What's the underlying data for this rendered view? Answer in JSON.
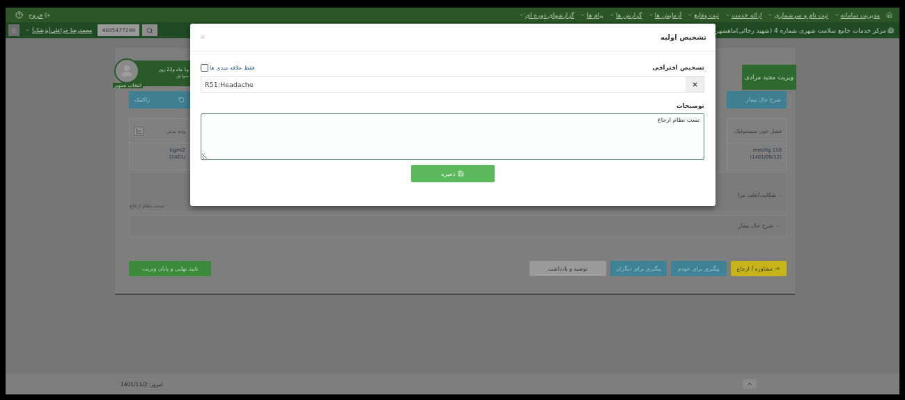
{
  "top_nav": {
    "menu": [
      {
        "label": "مدیریت سامانه"
      },
      {
        "label": "ثبت نام و سرشماری"
      },
      {
        "label": "ارائه خدمت"
      },
      {
        "label": "ثبت وقایع"
      },
      {
        "label": "آزمایش ها"
      },
      {
        "label": "گزارش ها"
      },
      {
        "label": "پیام ها"
      },
      {
        "label": "گزارشهای دوره ای"
      }
    ],
    "exit": "خروج"
  },
  "sub_nav": {
    "center": "مرکز خدمات جامع سلامت شهری شماره 4 (شهید رجائی)ماهشهر",
    "user": "محمدرضا خزاعلی(پزشک)",
    "search_value": "4605477299"
  },
  "patient": {
    "age": "و1 ماه و22 روز",
    "history_link": "سوابق",
    "choose_photo": "انتخاب تصویر"
  },
  "visit_tab": "ویزیت مجید مرادی",
  "left_column": {
    "button": "راکتیک",
    "vital_label": "وده بدنی",
    "vital_value": "kg/m2",
    "vital_date": "(1401/"
  },
  "right_column": {
    "button": "شرح حال بیمار",
    "vital_label": "فشار خون سیستولیک",
    "vital_value": "mm/Hg 110",
    "vital_date": "(1401/09/12)"
  },
  "complaint": {
    "title": "شکایت/علت مرا",
    "text": "تست نظام ارجاع",
    "expanded": true
  },
  "history_accordion": {
    "title": "شرح حال بیمار",
    "expanded": false
  },
  "actions": [
    {
      "label": "مشاوره / ارجاع",
      "kind": "warning"
    },
    {
      "label": "پیگیری برای خودم",
      "kind": "info"
    },
    {
      "label": "پیگیری برای دیگران",
      "kind": "info"
    },
    {
      "label": "توصیه و یادداشت",
      "kind": "default"
    }
  ],
  "finish_button": "تایید نهایی و پایان ویزیت",
  "footer": {
    "today": "امروز: 1401/11/2"
  },
  "modal": {
    "title": "تشخیص اولیه",
    "diagnosis_label": "تشخیص افتراقی",
    "favorites": {
      "label": "فقط علاقه مندی ها",
      "checked": false
    },
    "diagnosis_value": "R51:Headache",
    "notes_label": "توضیحات",
    "notes_value": "تست نظام ارجاع",
    "save": "ذخیره"
  }
}
